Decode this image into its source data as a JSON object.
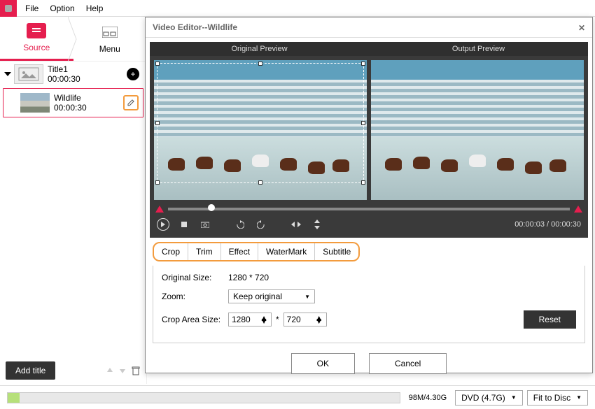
{
  "menubar": {
    "file": "File",
    "option": "Option",
    "help": "Help"
  },
  "steps": {
    "source": "Source",
    "menu": "Menu"
  },
  "sidebar": {
    "title1": {
      "name": "Title1",
      "dur": "00:00:30"
    },
    "clip": {
      "name": "Wildlife",
      "dur": "00:00:30"
    },
    "add_title": "Add title"
  },
  "dialog": {
    "title": "Video Editor--Wildlife",
    "orig_preview": "Original Preview",
    "out_preview": "Output Preview",
    "timecode": "00:00:03 / 00:00:30",
    "tabs": {
      "crop": "Crop",
      "trim": "Trim",
      "effect": "Effect",
      "watermark": "WaterMark",
      "subtitle": "Subtitle"
    },
    "opts": {
      "orig_size_lbl": "Original Size:",
      "orig_size_val": "1280 * 720",
      "zoom_lbl": "Zoom:",
      "zoom_val": "Keep original",
      "crop_lbl": "Crop Area Size:",
      "crop_w": "1280",
      "star": "*",
      "crop_h": "720",
      "reset": "Reset"
    },
    "ok": "OK",
    "cancel": "Cancel"
  },
  "footer": {
    "usage": "98M/4.30G",
    "disc": "DVD (4.7G)",
    "fit": "Fit to Disc"
  }
}
